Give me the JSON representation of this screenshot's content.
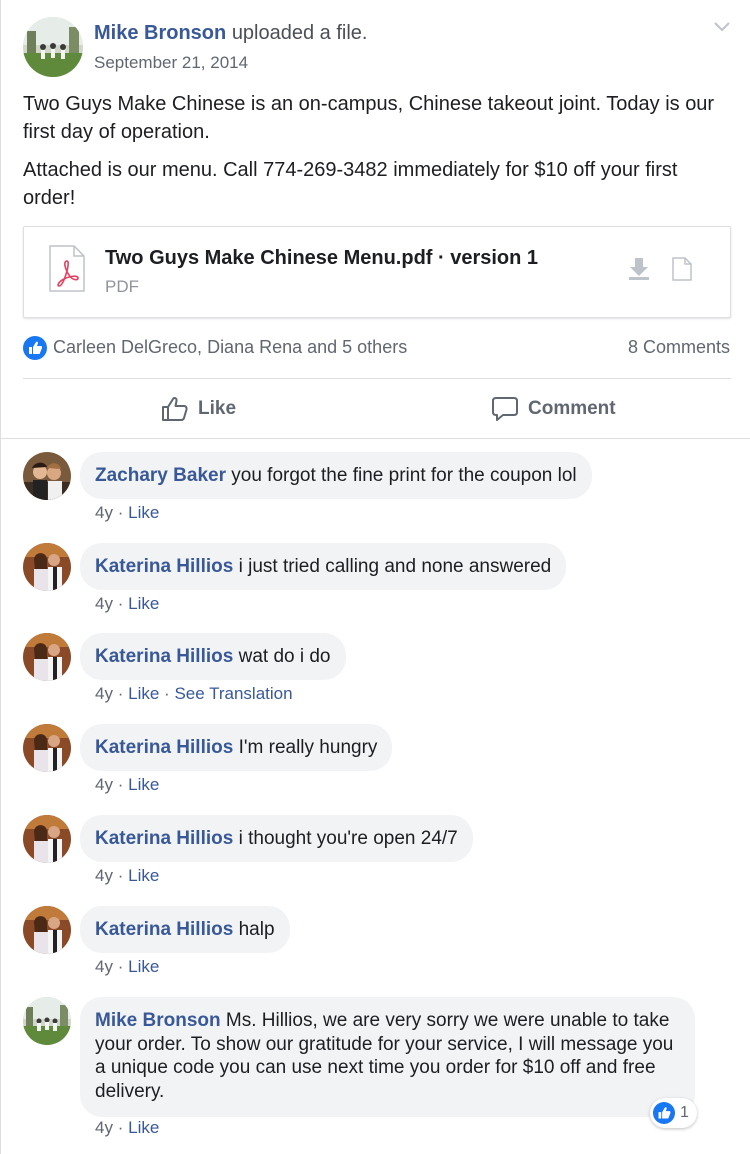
{
  "post": {
    "author": "Mike Bronson",
    "action": "uploaded a file.",
    "date": "September 21, 2014",
    "text_1": "Two Guys Make Chinese is an on-campus, Chinese takeout joint. Today is our first day of operation.",
    "text_2": "Attached is our menu. Call 774-269-3482 immediately for $10 off your first order!",
    "attachment": {
      "title": "Two Guys Make Chinese Menu.pdf · version 1",
      "type": "PDF",
      "icon": "pdf-icon"
    },
    "reactors": "Carleen DelGreco, Diana Rena and 5 others",
    "comment_count": "8 Comments",
    "like_label": "Like",
    "comment_label": "Comment"
  },
  "comments": [
    {
      "author": "Zachary Baker",
      "text": "you forgot the fine print for the coupon lol",
      "age": "4y",
      "like": "Like"
    },
    {
      "author": "Katerina Hillios",
      "text": "i just tried calling and none answered",
      "age": "4y",
      "like": "Like"
    },
    {
      "author": "Katerina Hillios",
      "text": "wat do i do",
      "age": "4y",
      "like": "Like",
      "translate": "See Translation"
    },
    {
      "author": "Katerina Hillios",
      "text": "I'm really hungry",
      "age": "4y",
      "like": "Like"
    },
    {
      "author": "Katerina Hillios",
      "text": "i thought you're open 24/7",
      "age": "4y",
      "like": "Like"
    },
    {
      "author": "Katerina Hillios",
      "text": "halp",
      "age": "4y",
      "like": "Like"
    },
    {
      "author": "Mike Bronson",
      "text": "Ms. Hillios, we are very sorry we were unable to take your order. To show our gratitude for your service, I will message you a unique code you can use next time you order for $10 off and free delivery.",
      "age": "4y",
      "like": "Like",
      "reaction_count": "1"
    }
  ],
  "separator": "·",
  "colors": {
    "link": "#385898",
    "like_blue": "#1877f2",
    "bubble": "#f2f3f5"
  }
}
